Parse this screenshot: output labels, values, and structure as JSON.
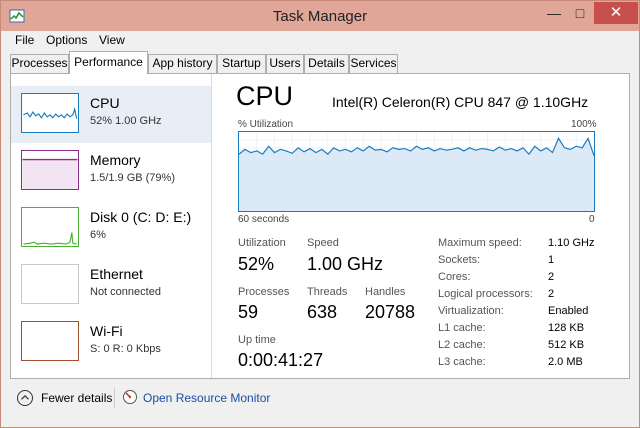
{
  "window": {
    "title": "Task Manager"
  },
  "window_controls": {
    "minimize": "—",
    "maximize": "□",
    "close": "✕"
  },
  "icons": {
    "app_icon": "task-manager-icon",
    "fewer_details": "chevron-up-icon",
    "resource_monitor": "resource-monitor-icon"
  },
  "colors": {
    "title_bar": "#e0a698",
    "close_button": "#c7504a",
    "cpu_accent": "#1a7bc0",
    "memory_accent": "#8b2c8b",
    "disk_accent": "#4caf30",
    "wifi_accent": "#a0522d",
    "link": "#1a4fa3"
  },
  "menu": [
    "File",
    "Options",
    "View"
  ],
  "tabs": [
    {
      "label": "Processes"
    },
    {
      "label": "Performance",
      "active": true
    },
    {
      "label": "App history"
    },
    {
      "label": "Startup"
    },
    {
      "label": "Users"
    },
    {
      "label": "Details"
    },
    {
      "label": "Services"
    }
  ],
  "resources": [
    {
      "name": "CPU",
      "detail": "52%  1.00 GHz",
      "selected": true
    },
    {
      "name": "Memory",
      "detail": "1.5/1.9 GB (79%)"
    },
    {
      "name": "Disk 0 (C: D: E:)",
      "detail": "6%"
    },
    {
      "name": "Ethernet",
      "detail": "Not connected"
    },
    {
      "name": "Wi-Fi",
      "detail": "S: 0 R: 0 Kbps"
    }
  ],
  "cpu": {
    "title": "CPU",
    "model": "Intel(R) Celeron(R) CPU 847 @ 1.10GHz",
    "graph_label_left": "% Utilization",
    "graph_label_right": "100%",
    "graph_time_left": "60 seconds",
    "graph_time_right": "0",
    "utilization_history": [
      72,
      78,
      74,
      76,
      72,
      82,
      74,
      78,
      76,
      73,
      80,
      75,
      79,
      74,
      78,
      72,
      80,
      76,
      78,
      75,
      80,
      76,
      82,
      77,
      78,
      75,
      80,
      78,
      79,
      76,
      82,
      78,
      80,
      76,
      79,
      77,
      78,
      80,
      76,
      80,
      77,
      79,
      78,
      76,
      81,
      77,
      79,
      76,
      80,
      72,
      82,
      76,
      80,
      74,
      92,
      80,
      78,
      82,
      80,
      92,
      70
    ],
    "utilization_label": "Utilization",
    "utilization_value": "52%",
    "speed_label": "Speed",
    "speed_value": "1.00 GHz",
    "processes_label": "Processes",
    "processes_value": "59",
    "threads_label": "Threads",
    "threads_value": "638",
    "handles_label": "Handles",
    "handles_value": "20788",
    "uptime_label": "Up time",
    "uptime_value": "0:00:41:27",
    "specs": [
      {
        "label": "Maximum speed:",
        "value": "1.10 GHz"
      },
      {
        "label": "Sockets:",
        "value": "1"
      },
      {
        "label": "Cores:",
        "value": "2"
      },
      {
        "label": "Logical processors:",
        "value": "2"
      },
      {
        "label": "Virtualization:",
        "value": "Enabled"
      },
      {
        "label": "L1 cache:",
        "value": "128 KB"
      },
      {
        "label": "L2 cache:",
        "value": "512 KB"
      },
      {
        "label": "L3 cache:",
        "value": "2.0 MB"
      }
    ]
  },
  "footer": {
    "fewer_details": "Fewer details",
    "open_resource_monitor": "Open Resource Monitor"
  }
}
